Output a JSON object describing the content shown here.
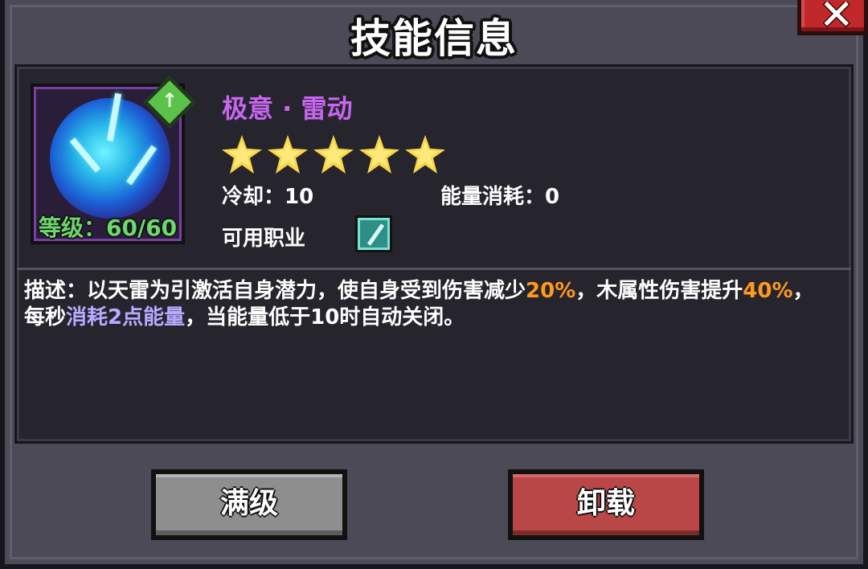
{
  "dialog": {
    "title": "技能信息",
    "close_label": "✕"
  },
  "skill": {
    "name": "极意 · 雷动",
    "level_label": "等级：60/60",
    "stars": 5,
    "cooldown": "冷却：10",
    "energy_cost": "能量消耗：0",
    "usable_class_label": "可用职业",
    "description": {
      "prefix": "描述：以天雷为引激活自身潜力，使自身受到伤害减少",
      "value1": "20%",
      "mid1": "，木属性伤害提升",
      "value2": "40%",
      "mid2": "，每秒",
      "cost": "消耗2点能量",
      "suffix": "，当能量低于10时自动关闭。"
    }
  },
  "buttons": {
    "max_level": "满级",
    "unequip": "卸载"
  },
  "colors": {
    "skill_name": "#c766f0",
    "highlight": "#ff9a1a",
    "energy_text": "#b9a9ff",
    "level_text": "#6dd86d"
  }
}
